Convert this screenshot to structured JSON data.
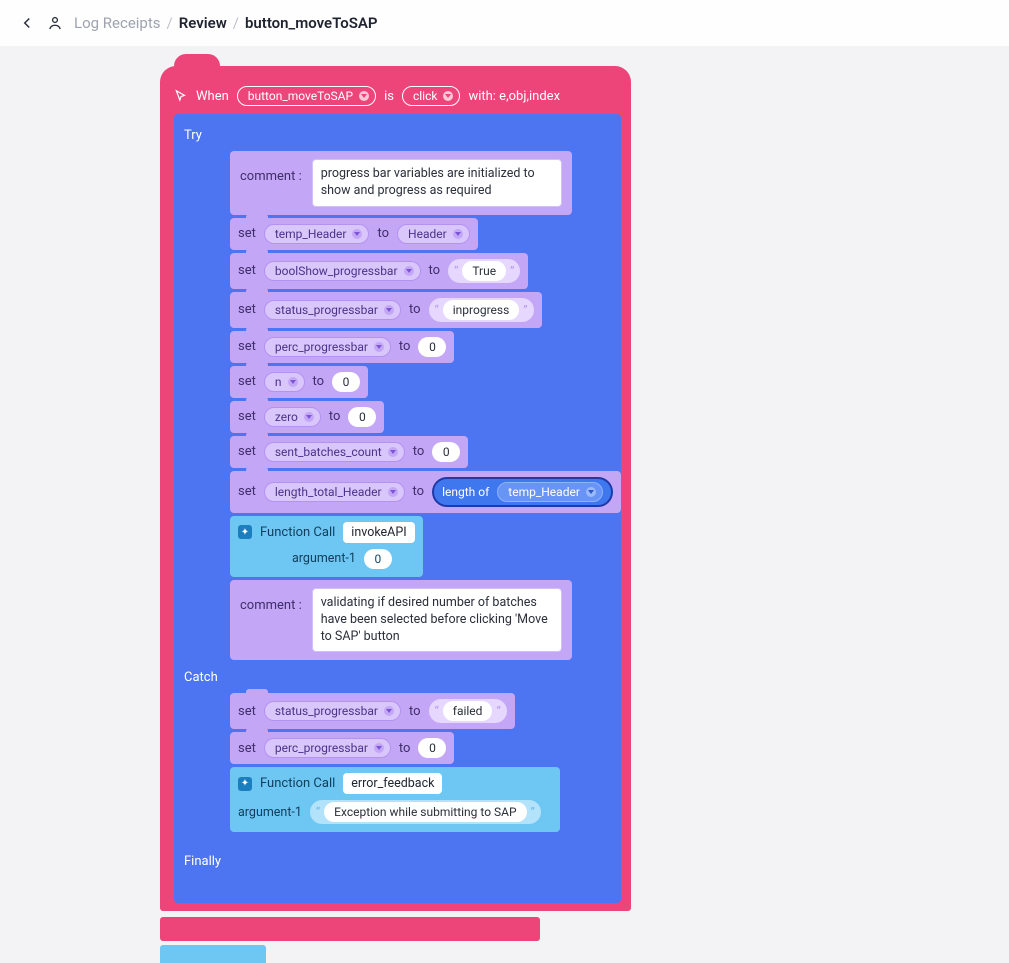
{
  "breadcrumbs": {
    "root": "Log Receipts",
    "mid": "Review",
    "leaf": "button_moveToSAP"
  },
  "event": {
    "when": "When",
    "target": "button_moveToSAP",
    "is": "is",
    "action": "click",
    "with_label": "with: e,obj,index"
  },
  "sections": {
    "try": "Try",
    "catch": "Catch",
    "finally": "Finally"
  },
  "kw": {
    "set": "set",
    "to": "to",
    "comment": "comment :",
    "func": "Function Call",
    "arg1": "argument-1",
    "lengthof": "length of"
  },
  "try_rows": {
    "comment1": "progress bar variables are initialized to show and progress as required",
    "r1_var": "temp_Header",
    "r1_val": "Header",
    "r2_var": "boolShow_progressbar",
    "r2_val": "True",
    "r3_var": "status_progressbar",
    "r3_val": "inprogress",
    "r4_var": "perc_progressbar",
    "r4_val": "0",
    "r5_var": "n",
    "r5_val": "0",
    "r6_var": "zero",
    "r6_val": "0",
    "r7_var": "sent_batches_count",
    "r7_val": "0",
    "r8_var": "length_total_Header",
    "r8_src": "temp_Header",
    "fn1_name": "invokeAPI",
    "fn1_arg": "0",
    "comment2": "validating if desired number of batches have been selected before clicking 'Move to SAP' button"
  },
  "catch_rows": {
    "r1_var": "status_progressbar",
    "r1_val": "failed",
    "r2_var": "perc_progressbar",
    "r2_val": "0",
    "fn_name": "error_feedback",
    "fn_arg": "Exception while submitting to SAP"
  }
}
